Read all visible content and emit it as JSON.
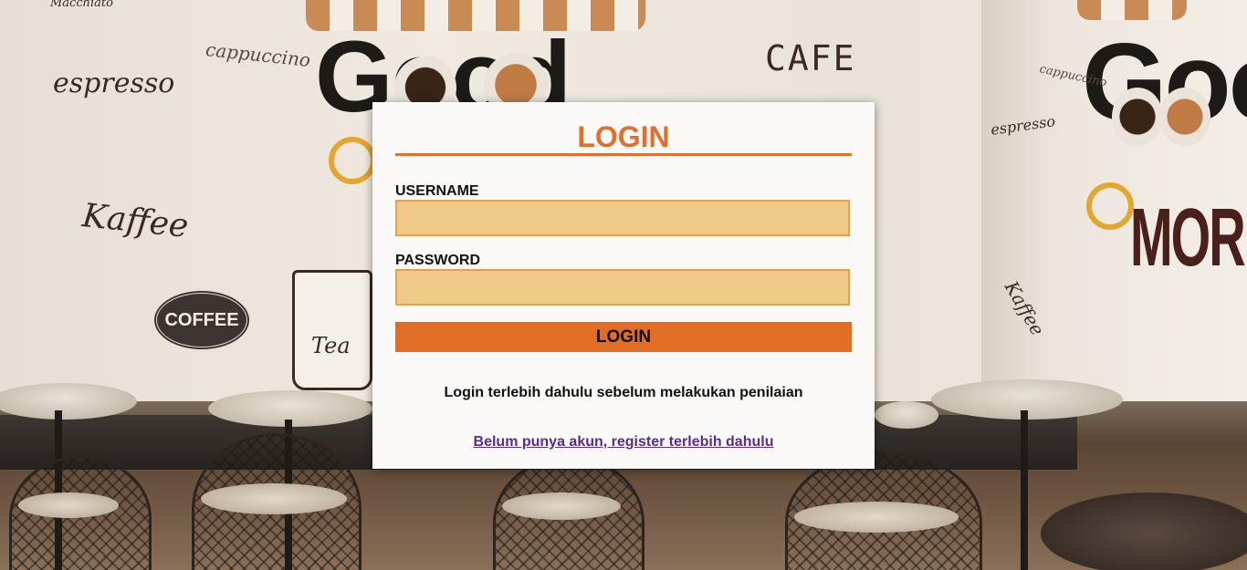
{
  "background": {
    "doodles": {
      "macchiato": "Macchiato",
      "espresso": "espresso",
      "cappuccino": "cappuccino",
      "cafe": "CAFE",
      "good": "Good",
      "kaffee": "Kaffee",
      "coffee_badge": "COFFEE",
      "tea": "Tea",
      "good_right": "Good",
      "morning": "MORNING",
      "espresso_right": "espresso",
      "cappuccino_right": "cappuccino",
      "kaffee_right": "Kaffee"
    }
  },
  "login": {
    "title": "LOGIN",
    "username_label": "USERNAME",
    "username_value": "",
    "password_label": "PASSWORD",
    "password_value": "",
    "submit_label": "LOGIN",
    "note": "Login terlebih dahulu sebelum melakukan penilaian",
    "register_link": "Belum punya akun, register terlebih dahulu"
  },
  "colors": {
    "accent": "#e0712c",
    "button": "#e26e25",
    "input_fill": "#f0c987",
    "input_border": "#e8a045",
    "link": "#5a2c8c"
  }
}
